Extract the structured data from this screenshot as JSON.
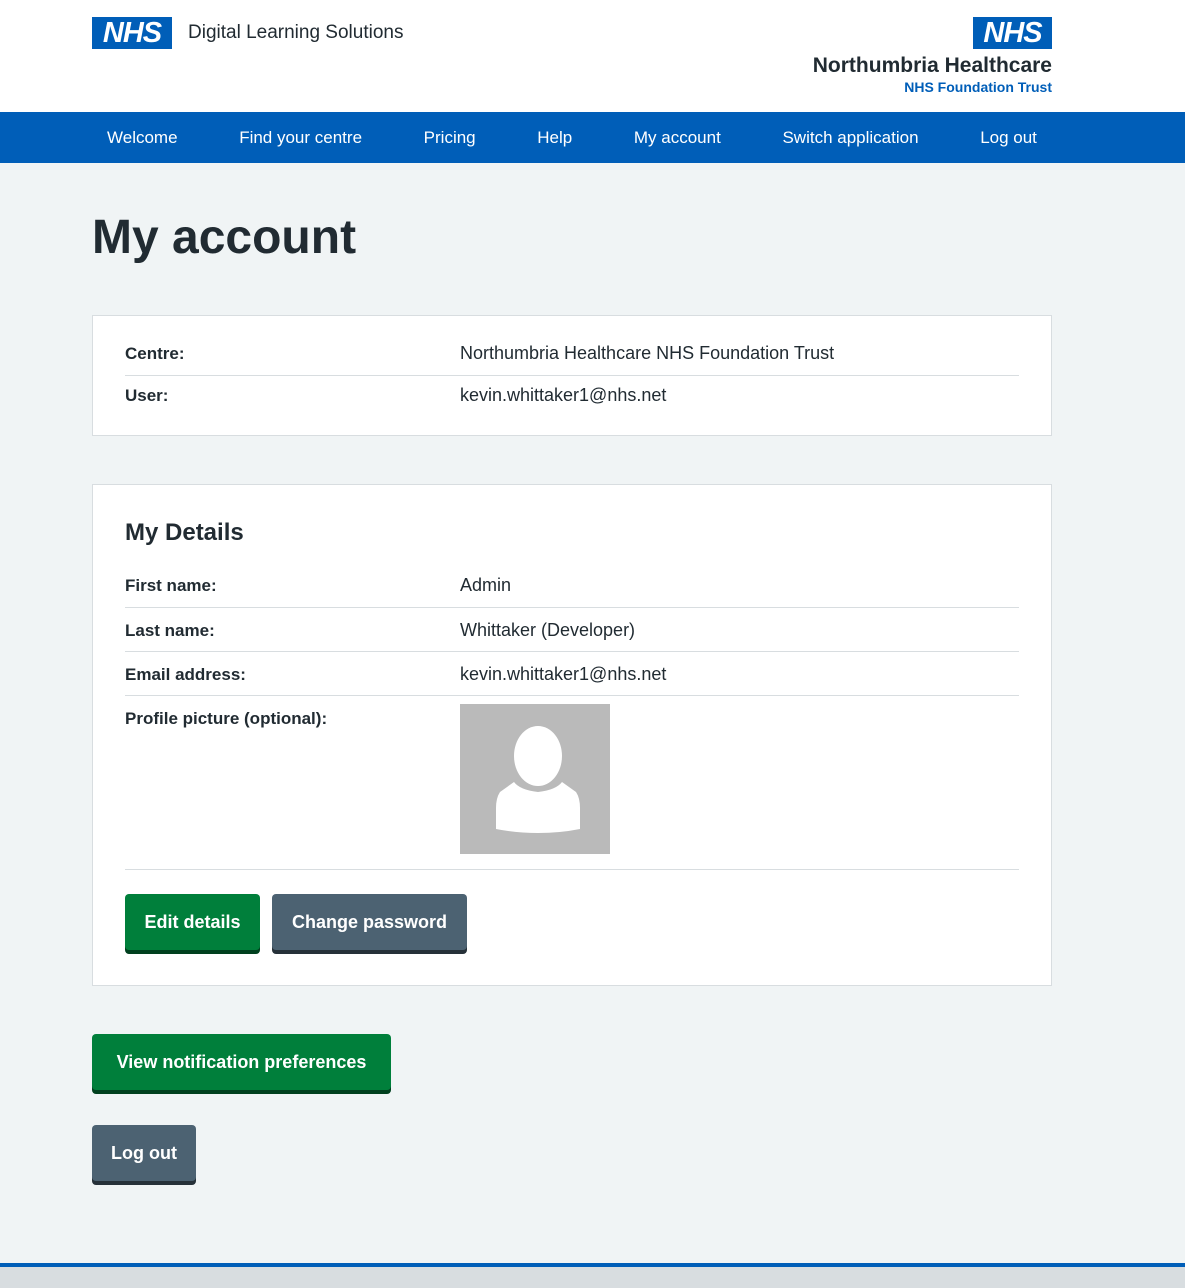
{
  "header": {
    "logo_text": "NHS",
    "app_title": "Digital Learning Solutions",
    "org_logo_text": "NHS",
    "org_name": "Northumbria Healthcare",
    "org_subtitle": "NHS Foundation Trust"
  },
  "nav": {
    "items": [
      {
        "label": "Welcome"
      },
      {
        "label": "Find your centre"
      },
      {
        "label": "Pricing"
      },
      {
        "label": "Help"
      },
      {
        "label": "My account"
      },
      {
        "label": "Switch application"
      },
      {
        "label": "Log out"
      }
    ]
  },
  "page": {
    "title": "My account"
  },
  "summary": {
    "centre_label": "Centre:",
    "centre_value": "Northumbria Healthcare NHS Foundation Trust",
    "user_label": "User:",
    "user_value": "kevin.whittaker1@nhs.net"
  },
  "details": {
    "heading": "My Details",
    "first_name_label": "First name:",
    "first_name_value": "Admin",
    "last_name_label": "Last name:",
    "last_name_value": "Whittaker (Developer)",
    "email_label": "Email address:",
    "email_value": "kevin.whittaker1@nhs.net",
    "picture_label": "Profile picture (optional):",
    "avatar_icon": "user-silhouette-icon",
    "edit_button": "Edit details",
    "password_button": "Change password"
  },
  "actions": {
    "notifications_button": "View notification preferences",
    "logout_button": "Log out"
  },
  "colors": {
    "nhs_blue": "#005eb8",
    "button_green": "#007f3b",
    "button_grey": "#4c6272",
    "background": "#f0f4f5"
  }
}
